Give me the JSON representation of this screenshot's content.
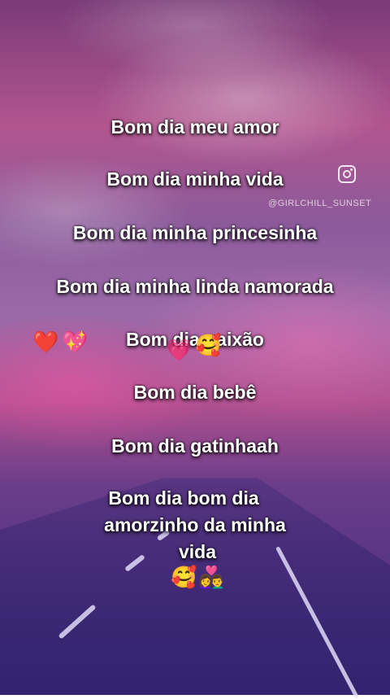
{
  "lines": [
    "Bom dia meu amor",
    "Bom dia minha vida",
    "Bom dia minha princesinha",
    "Bom dia minha linda namorada",
    "Bom dia paixão",
    "Bom dia bebê",
    "Bom dia gatinhaah",
    "Bom dia bom dia",
    "amorzinho da minha",
    "vida"
  ],
  "watermark": {
    "icon": "instagram-icon",
    "handle": "@GIRLCHILL_SUNSET"
  },
  "emojis": {
    "left_heart": "❤️",
    "left_sparkle_heart": "💖",
    "mid_heart": "💗",
    "mid_hug_face": "🥰",
    "bottom_hug_face": "🥰",
    "bottom_couple": "👩‍❤️‍👨"
  }
}
